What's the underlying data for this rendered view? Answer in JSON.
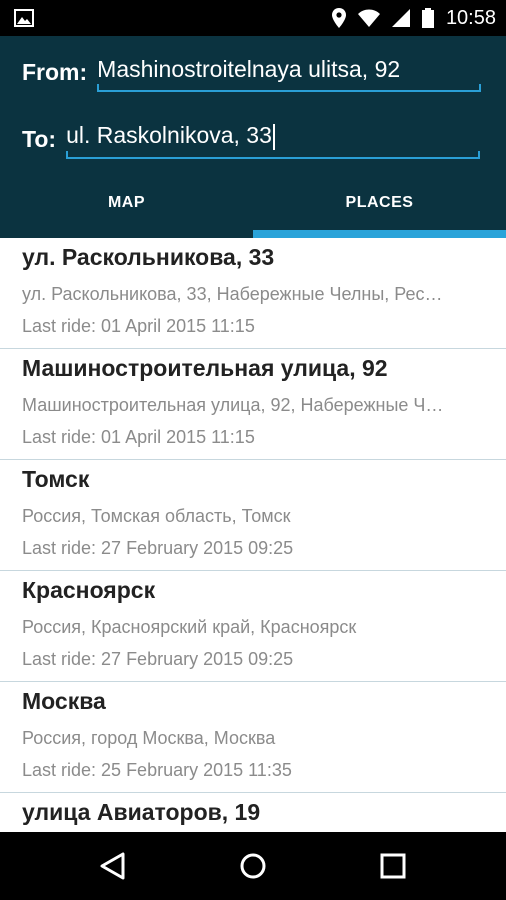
{
  "status_bar": {
    "time": "10:58",
    "left_icon": "image-icon",
    "right_icons": [
      "location-icon",
      "wifi-icon",
      "signal-icon",
      "battery-icon"
    ]
  },
  "form": {
    "from_label": "From:",
    "from_value": "Mashinostroitelnaya ulitsa, 92",
    "to_label": "To:",
    "to_value": "ul. Raskolnikova, 33"
  },
  "tabs": [
    {
      "label": "MAP",
      "active": false
    },
    {
      "label": "PLACES",
      "active": true
    }
  ],
  "places": [
    {
      "title": "ул. Раскольникова, 33",
      "subtitle": "ул. Раскольникова, 33, Набережные Челны, Рес…",
      "last_ride": "Last ride: 01 April 2015 11:15"
    },
    {
      "title": "Машиностроительная улица, 92",
      "subtitle": "Машиностроительная улица, 92, Набережные Ч…",
      "last_ride": "Last ride: 01 April 2015 11:15"
    },
    {
      "title": "Томск",
      "subtitle": "Россия, Томская область, Томск",
      "last_ride": "Last ride: 27 February 2015 09:25"
    },
    {
      "title": "Красноярск",
      "subtitle": "Россия, Красноярский край, Красноярск",
      "last_ride": "Last ride: 27 February 2015 09:25"
    },
    {
      "title": "Москва",
      "subtitle": "Россия, город Москва, Москва",
      "last_ride": "Last ride: 25 February 2015 11:35"
    },
    {
      "title": "улица Авиаторов, 19",
      "subtitle": "",
      "last_ride": ""
    }
  ],
  "colors": {
    "header_bg": "#0b3340",
    "accent": "#2aa3d9"
  },
  "nav_icons": [
    "back-icon",
    "home-icon",
    "recents-icon"
  ]
}
